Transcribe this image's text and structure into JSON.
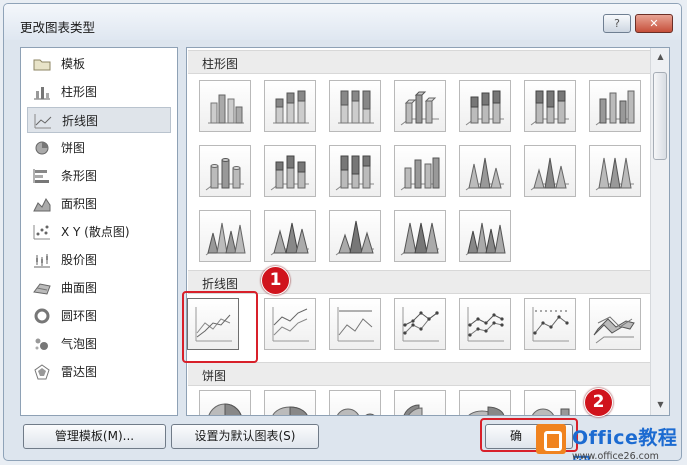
{
  "window": {
    "title": "更改图表类型",
    "help_label": "?",
    "close_label": "✕"
  },
  "categories": [
    {
      "label": "模板",
      "icon": "folder-icon",
      "selected": false
    },
    {
      "label": "柱形图",
      "icon": "column-chart-icon",
      "selected": false
    },
    {
      "label": "折线图",
      "icon": "line-chart-icon",
      "selected": true
    },
    {
      "label": "饼图",
      "icon": "pie-chart-icon",
      "selected": false
    },
    {
      "label": "条形图",
      "icon": "bar-chart-icon",
      "selected": false
    },
    {
      "label": "面积图",
      "icon": "area-chart-icon",
      "selected": false
    },
    {
      "label": "X Y (散点图)",
      "icon": "scatter-chart-icon",
      "selected": false
    },
    {
      "label": "股价图",
      "icon": "stock-chart-icon",
      "selected": false
    },
    {
      "label": "曲面图",
      "icon": "surface-chart-icon",
      "selected": false
    },
    {
      "label": "圆环图",
      "icon": "doughnut-chart-icon",
      "selected": false
    },
    {
      "label": "气泡图",
      "icon": "bubble-chart-icon",
      "selected": false
    },
    {
      "label": "雷达图",
      "icon": "radar-chart-icon",
      "selected": false
    }
  ],
  "sections": {
    "column": {
      "label": "柱形图"
    },
    "line": {
      "label": "折线图"
    },
    "pie": {
      "label": "饼图"
    }
  },
  "buttons": {
    "manage_templates": "管理模板(M)...",
    "set_default": "设置为默认图表(S)",
    "ok": "确"
  },
  "annotations": {
    "step1": "1",
    "step2": "2"
  },
  "watermark": {
    "brand": "Office教程网",
    "url": "www.office26.com"
  },
  "colors": {
    "highlight": "#d8202a",
    "badge": "#d0131c"
  }
}
